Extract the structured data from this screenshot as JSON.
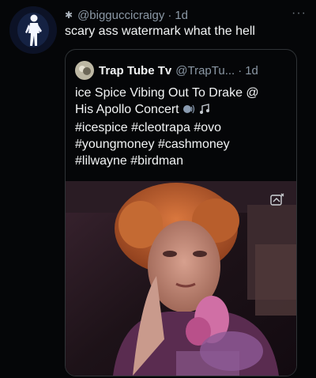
{
  "tweet": {
    "handle": "@bigguccicraigy",
    "separator": "·",
    "time": "1d",
    "text": "scary ass watermark what the hell",
    "more_icon": "more-horizontal-icon"
  },
  "quote": {
    "name": "Trap Tube Tv",
    "handle": "@TrapTu...",
    "separator": "·",
    "time": "1d",
    "line1": "ice Spice Vibing Out To Drake @",
    "line2": "His Apollo Concert",
    "line3": "#icespice #cleotrapa #ovo",
    "line4": "#youngmoney #cashmoney",
    "line5": "#lilwayne #birdman",
    "media_icon": "watermark-icon"
  },
  "colors": {
    "background": "#050608",
    "text_primary": "#e7e9ea",
    "text_secondary": "#8b98a5",
    "border": "#2f3336"
  }
}
